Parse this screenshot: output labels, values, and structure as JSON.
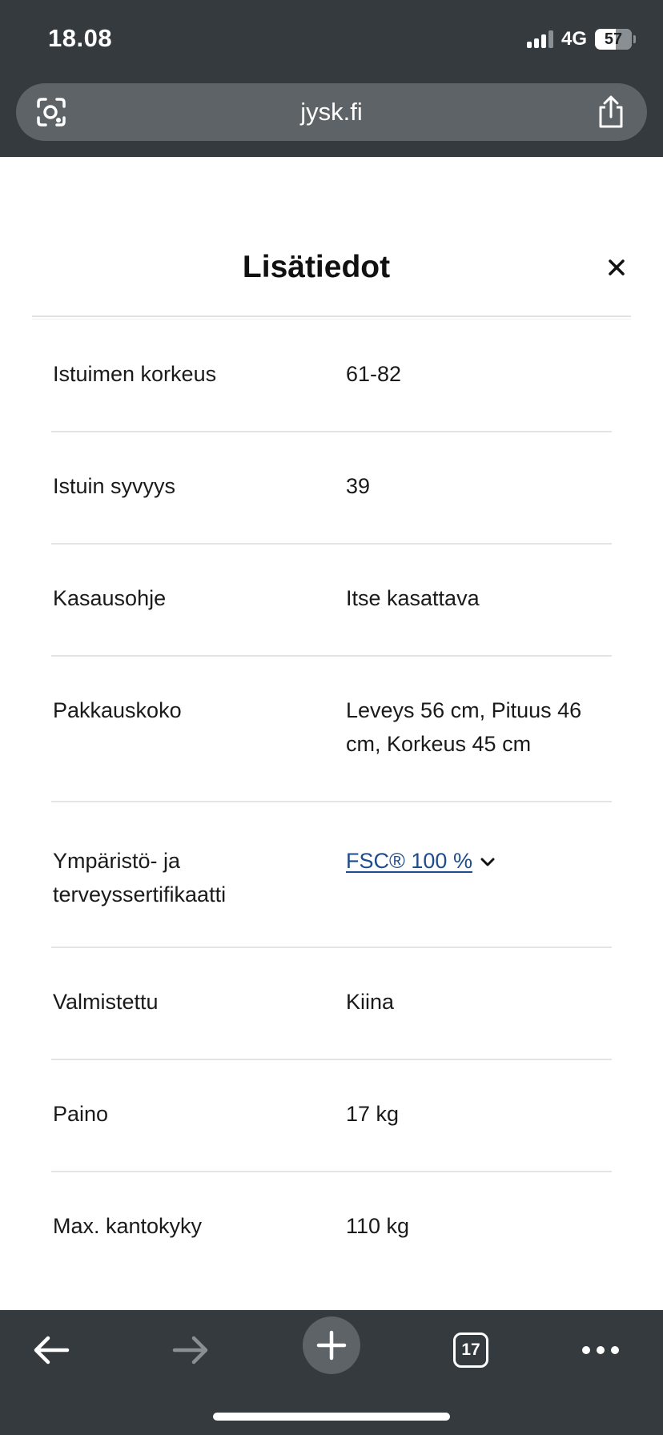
{
  "status_bar": {
    "time": "18.08",
    "network": "4G",
    "battery": "57"
  },
  "browser": {
    "url": "jysk.fi",
    "tab_count": "17"
  },
  "modal": {
    "title": "Lisätiedot",
    "close_glyph": "×",
    "rows": [
      {
        "label": "Istuimen korkeus",
        "value": "61-82"
      },
      {
        "label": "Istuin syvyys",
        "value": "39"
      },
      {
        "label": "Kasausohje",
        "value": "Itse kasattava"
      },
      {
        "label": "Pakkauskoko",
        "value": "Leveys 56 cm, Pituus 46 cm, Korkeus 45 cm"
      },
      {
        "label": "Ympäristö- ja terveyssertifikaatti",
        "value": "FSC® 100 %",
        "is_link": true
      },
      {
        "label": "Valmistettu",
        "value": "Kiina"
      },
      {
        "label": "Paino",
        "value": "17 kg"
      },
      {
        "label": "Max. kantokyky",
        "value": "110 kg"
      }
    ]
  },
  "colors": {
    "chrome": "#353a3f",
    "url_bar": "#5e6367",
    "link": "#1e4c8c",
    "divider": "#e4e4e4"
  }
}
